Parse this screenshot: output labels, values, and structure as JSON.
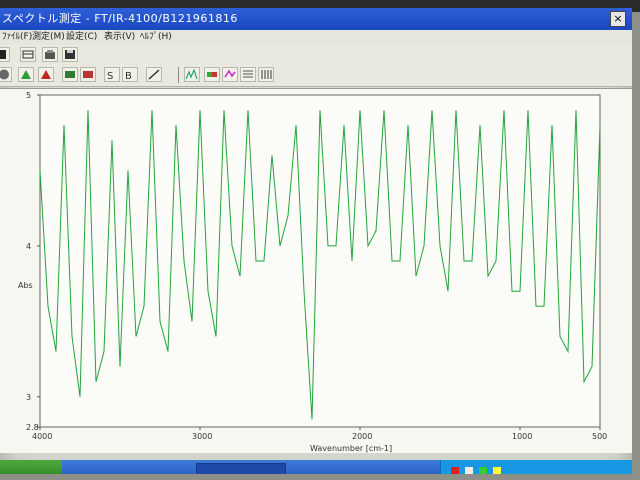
{
  "window": {
    "title": "スペクトル測定 - FT/IR-4100/B121961816"
  },
  "menu": [
    "ﾌｧｲﾙ(F)",
    "測定(M)",
    "設定(C)",
    "表示(V)",
    "ﾍﾙﾌﾟ(H)"
  ],
  "toolbar1": [
    "save-icon",
    "panel-icon",
    "open-icon",
    "save-disk-icon"
  ],
  "toolbar2": [
    "circle-icon",
    "collect-green-icon",
    "collect-red-icon",
    "sample-icon",
    "background-icon",
    "sample-b-icon",
    "background-b-icon",
    "script-icon",
    "peak-icon",
    "scale-icon",
    "zoom-icon",
    "grid-icon",
    "table-icon"
  ],
  "colors": {
    "spectrum": "#22a33a",
    "title_bar": "#2456c8",
    "taskbar": "#2a62cb"
  },
  "chart_data": {
    "type": "line",
    "xlabel": "Wavenumber [cm-1]",
    "ylabel": "Abs",
    "xlim": [
      4000,
      500
    ],
    "ylim": [
      2.8,
      5
    ],
    "x_ticks": [
      "4000",
      "3000",
      "2000",
      "1000",
      "500"
    ],
    "y_ticks": [
      "5",
      "4",
      "3",
      "2.8"
    ],
    "grid": false,
    "series": [
      {
        "x": [
          4000,
          3950,
          3900,
          3850,
          3800,
          3750,
          3700,
          3650,
          3600,
          3550,
          3500,
          3450,
          3400,
          3350,
          3300,
          3250,
          3200,
          3150,
          3100,
          3050,
          3000,
          2950,
          2900,
          2850,
          2800,
          2750,
          2700,
          2650,
          2600,
          2550,
          2500,
          2450,
          2400,
          2350,
          2300,
          2250,
          2200,
          2150,
          2100,
          2050,
          2000,
          1950,
          1900,
          1850,
          1800,
          1750,
          1700,
          1650,
          1600,
          1550,
          1500,
          1450,
          1400,
          1350,
          1300,
          1250,
          1200,
          1150,
          1100,
          1050,
          1000,
          950,
          900,
          850,
          800,
          750,
          700,
          650,
          600,
          550,
          500
        ],
        "y": [
          4.5,
          3.6,
          3.3,
          4.8,
          3.4,
          3.0,
          4.9,
          3.1,
          3.3,
          4.7,
          3.2,
          4.5,
          3.4,
          3.6,
          4.9,
          3.5,
          3.3,
          4.8,
          3.9,
          3.5,
          4.9,
          3.7,
          3.4,
          4.9,
          4.0,
          3.8,
          4.9,
          3.9,
          3.9,
          4.6,
          4.0,
          4.2,
          4.8,
          3.7,
          2.85,
          4.9,
          4.0,
          4.0,
          4.8,
          3.9,
          4.9,
          4.0,
          4.1,
          4.9,
          3.9,
          3.9,
          4.8,
          3.8,
          4.0,
          4.9,
          4.0,
          3.7,
          4.9,
          3.9,
          3.9,
          4.8,
          3.8,
          3.9,
          4.9,
          3.7,
          3.7,
          4.9,
          3.6,
          3.6,
          4.8,
          3.4,
          3.3,
          4.9,
          3.1,
          3.2,
          4.8
        ]
      }
    ]
  }
}
